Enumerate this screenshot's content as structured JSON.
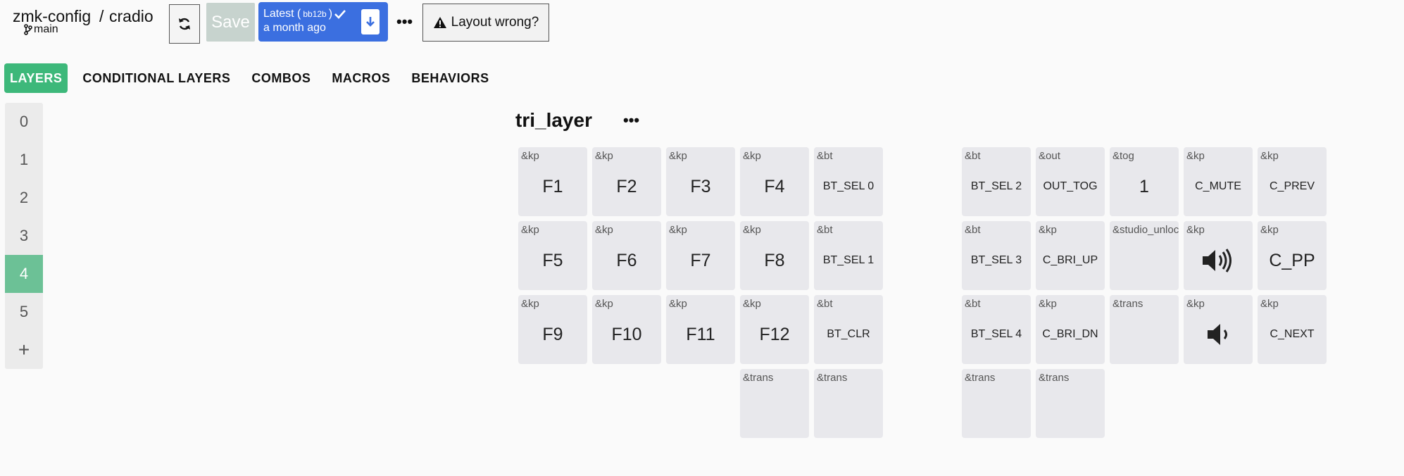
{
  "header": {
    "repo": "zmk-config",
    "separator": "/",
    "keyboard": "cradio",
    "branch": "main",
    "save_label": "Save",
    "latest_label": "Latest (",
    "latest_hash": "bb12b",
    "latest_close": ")",
    "latest_time": "a month ago",
    "more": "•••",
    "layout_wrong_label": "Layout wrong?"
  },
  "tabs": [
    {
      "label": "LAYERS",
      "active": true
    },
    {
      "label": "CONDITIONAL LAYERS"
    },
    {
      "label": "COMBOS"
    },
    {
      "label": "MACROS"
    },
    {
      "label": "BEHAVIORS"
    }
  ],
  "layers": {
    "items": [
      "0",
      "1",
      "2",
      "3",
      "4",
      "5"
    ],
    "active": "4",
    "add": "+"
  },
  "layer": {
    "title": "tri_layer",
    "menu": "•••"
  },
  "keys": [
    {
      "binding": "&kp",
      "param": "F1"
    },
    {
      "binding": "&kp",
      "param": "F2"
    },
    {
      "binding": "&kp",
      "param": "F3"
    },
    {
      "binding": "&kp",
      "param": "F4"
    },
    {
      "binding": "&bt",
      "param": "BT_SEL 0"
    },
    {
      "binding": "&bt",
      "param": "BT_SEL 2"
    },
    {
      "binding": "&out",
      "param": "OUT_TOG"
    },
    {
      "binding": "&tog",
      "param": "1"
    },
    {
      "binding": "&kp",
      "param": "C_MUTE"
    },
    {
      "binding": "&kp",
      "param": "C_PREV"
    },
    {
      "binding": "&kp",
      "param": "F5"
    },
    {
      "binding": "&kp",
      "param": "F6"
    },
    {
      "binding": "&kp",
      "param": "F7"
    },
    {
      "binding": "&kp",
      "param": "F8"
    },
    {
      "binding": "&bt",
      "param": "BT_SEL 1"
    },
    {
      "binding": "&bt",
      "param": "BT_SEL 3"
    },
    {
      "binding": "&kp",
      "param": "C_BRI_UP"
    },
    {
      "binding": "&studio_unlock",
      "param": ""
    },
    {
      "binding": "&kp",
      "param": "",
      "icon": "volume-up-icon"
    },
    {
      "binding": "&kp",
      "param": "C_PP"
    },
    {
      "binding": "&kp",
      "param": "F9"
    },
    {
      "binding": "&kp",
      "param": "F10"
    },
    {
      "binding": "&kp",
      "param": "F11"
    },
    {
      "binding": "&kp",
      "param": "F12"
    },
    {
      "binding": "&bt",
      "param": "BT_CLR"
    },
    {
      "binding": "&bt",
      "param": "BT_SEL 4"
    },
    {
      "binding": "&kp",
      "param": "C_BRI_DN"
    },
    {
      "binding": "&trans",
      "param": ""
    },
    {
      "binding": "&kp",
      "param": "",
      "icon": "volume-down-icon"
    },
    {
      "binding": "&kp",
      "param": "C_NEXT"
    },
    {
      "binding": "&trans",
      "param": ""
    },
    {
      "binding": "&trans",
      "param": ""
    },
    {
      "binding": "&trans",
      "param": ""
    },
    {
      "binding": "&trans",
      "param": ""
    }
  ],
  "colors": {
    "accent": "#3db87a",
    "latest_bg": "#3b6fe0",
    "key_bg": "#e8e8ec"
  }
}
